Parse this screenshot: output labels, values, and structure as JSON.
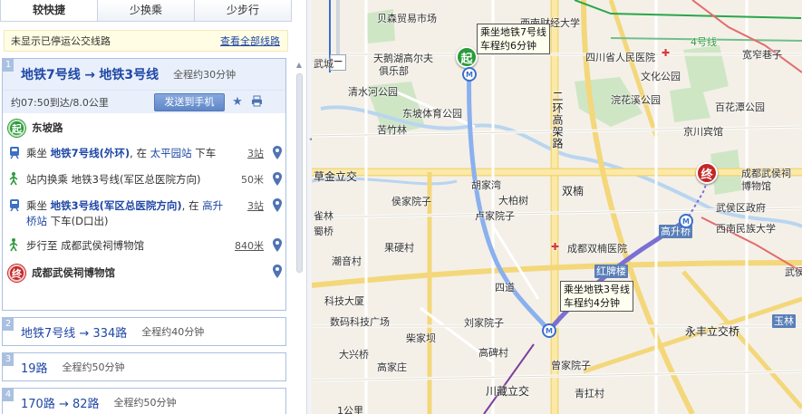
{
  "tabs": [
    {
      "label": "较快捷"
    },
    {
      "label": "少换乘"
    },
    {
      "label": "少步行"
    }
  ],
  "notice": {
    "text": "未显示已停运公交线路",
    "link": "查看全部线路"
  },
  "active_plan": {
    "num": "1",
    "line1": "地铁7号线",
    "arrow": "→",
    "line2": "地铁3号线",
    "duration": "全程约30分钟",
    "summary": "约07:50到达/8.0公里",
    "send_button": "发送到手机",
    "steps": {
      "start": {
        "label": "东坡路"
      },
      "ride1": {
        "prefix": "乘坐",
        "line": "地铁7号线(外环)",
        "mid": ", 在",
        "stop": "太平园站",
        "suffix": "下车",
        "count": "3站"
      },
      "transfer": {
        "text": "站内换乘 地铁3号线(军区总医院方向)",
        "dist": "50米"
      },
      "ride2": {
        "prefix": "乘坐",
        "line": "地铁3号线(军区总医院方向)",
        "mid": ", 在",
        "stop": "高升桥站",
        "suffix": "下车(D口出)",
        "count": "3站"
      },
      "walk": {
        "text": "步行至 成都武侯祠博物馆",
        "dist": "840米"
      },
      "end": {
        "label": "成都武侯祠博物馆"
      }
    }
  },
  "other_plans": [
    {
      "num": "2",
      "title": "地铁7号线 → 334路",
      "duration": "全程约40分钟"
    },
    {
      "num": "3",
      "title": "19路",
      "duration": "全程约50分钟"
    },
    {
      "num": "4",
      "title": "170路 → 82路",
      "duration": "全程约50分钟"
    }
  ],
  "map": {
    "callout1": {
      "line1": "乘坐地铁7号线",
      "line2": "车程约6分钟"
    },
    "callout2": {
      "line1": "乘坐地铁3号线",
      "line2": "车程约4分钟"
    },
    "start_marker": "起",
    "end_marker": "终",
    "labels": {
      "beiyi": "贝森贸易市场",
      "xinan": "西南财经大学",
      "sichuan_hosp": "四川省人民医院",
      "kuanzhai": "宽窄巷子",
      "line4": "4号线",
      "wenhua": "文化公园",
      "huanhua": "浣花溪公园",
      "baihuatan": "百花潭公园",
      "jingchuan": "京川宾馆",
      "tianpeng": "天鹅湖高尔夫",
      "julebu": "俱乐部",
      "qingshui": "清水河公园",
      "dongpo": "东坡体育公园",
      "kuzhulin": "苦竹林",
      "erhuan": "二环高架路",
      "shuanggiao": "双楠",
      "wuhouci_mus": "成都武侯祠",
      "bowuguan": "博物馆",
      "wuhou_gov": "武侯区政府",
      "xinan_minzu": "西南民族大学",
      "gaosheng": "高升桥",
      "caojin": "草金立交",
      "hujiawan": "胡家湾",
      "houjia": "侯家院子",
      "dabailin": "大柏树",
      "lujia": "卢家院子",
      "shuangnan_hosp": "成都双楠医院",
      "guoteng": "果硬村",
      "hongpai": "红牌楼",
      "sidong": "四道",
      "kejijidi": "科技大厦",
      "shuma": "数码科技广场",
      "liujia": "刘家院子",
      "chaijia": "柴家坝",
      "gaobei": "高碑村",
      "daxing": "大兴桥",
      "gaojia": "高家庄",
      "caojia": "曾家院子",
      "qinggang": "青扛村",
      "chuanzang": "川藏立交",
      "yongfeng": "永丰立交桥",
      "yulin": "玉林",
      "wuhou_tri": "武侯立",
      "chaohu": "潮音村",
      "cuolin": "雀林",
      "shuqiao": "蜀桥",
      "wucheng": "武城",
      "scale": "1公里"
    }
  },
  "colors": {
    "accent": "#1f47a6",
    "start": "#2e9a3c",
    "end": "#c62828",
    "metro7": "#8ab0ee",
    "metro3": "#7b6fd6"
  }
}
